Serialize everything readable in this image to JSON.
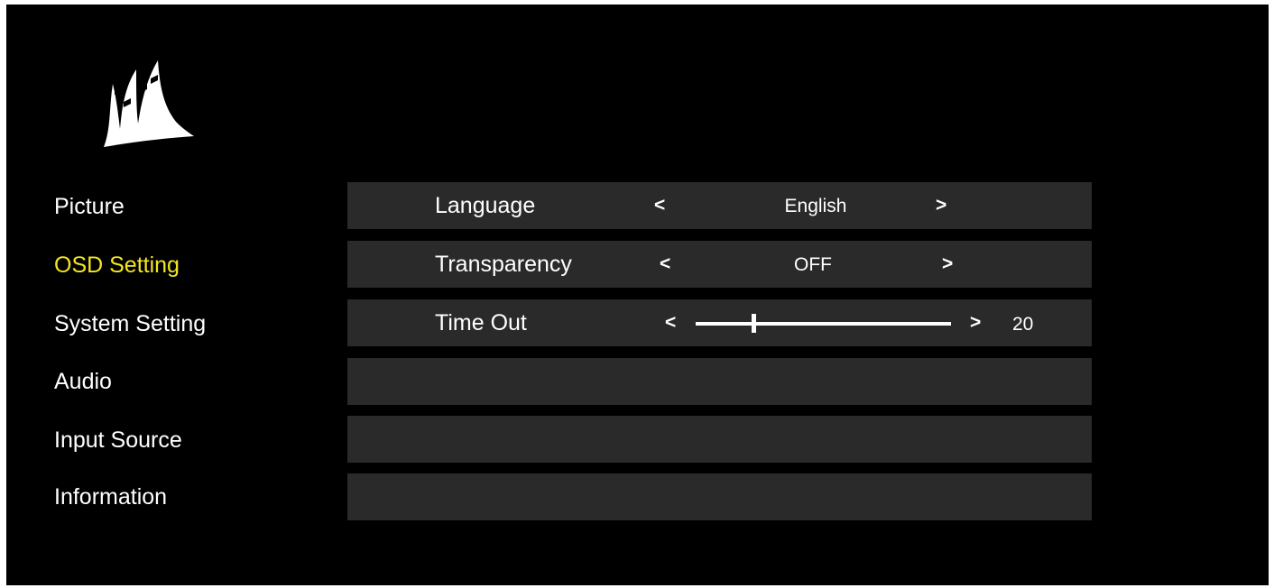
{
  "logo": {
    "icon": "corsair-sails-icon"
  },
  "sidebar": {
    "items": [
      {
        "label": "Picture",
        "active": false
      },
      {
        "label": "OSD Setting",
        "active": true
      },
      {
        "label": "System Setting",
        "active": false
      },
      {
        "label": "Audio",
        "active": false
      },
      {
        "label": "Input Source",
        "active": false
      },
      {
        "label": "Information",
        "active": false
      }
    ]
  },
  "settings": {
    "language": {
      "label": "Language",
      "value": "English",
      "prev": "<",
      "next": ">"
    },
    "transparency": {
      "label": "Transparency",
      "value": "OFF",
      "prev": "<",
      "next": ">"
    },
    "time_out": {
      "label": "Time Out",
      "value": "20",
      "prev": "<",
      "next": ">",
      "level": 0.2
    }
  },
  "colors": {
    "background": "#000000",
    "panel": "#2a2a2a",
    "text": "#ffffff",
    "active_text": "#f3e620"
  }
}
